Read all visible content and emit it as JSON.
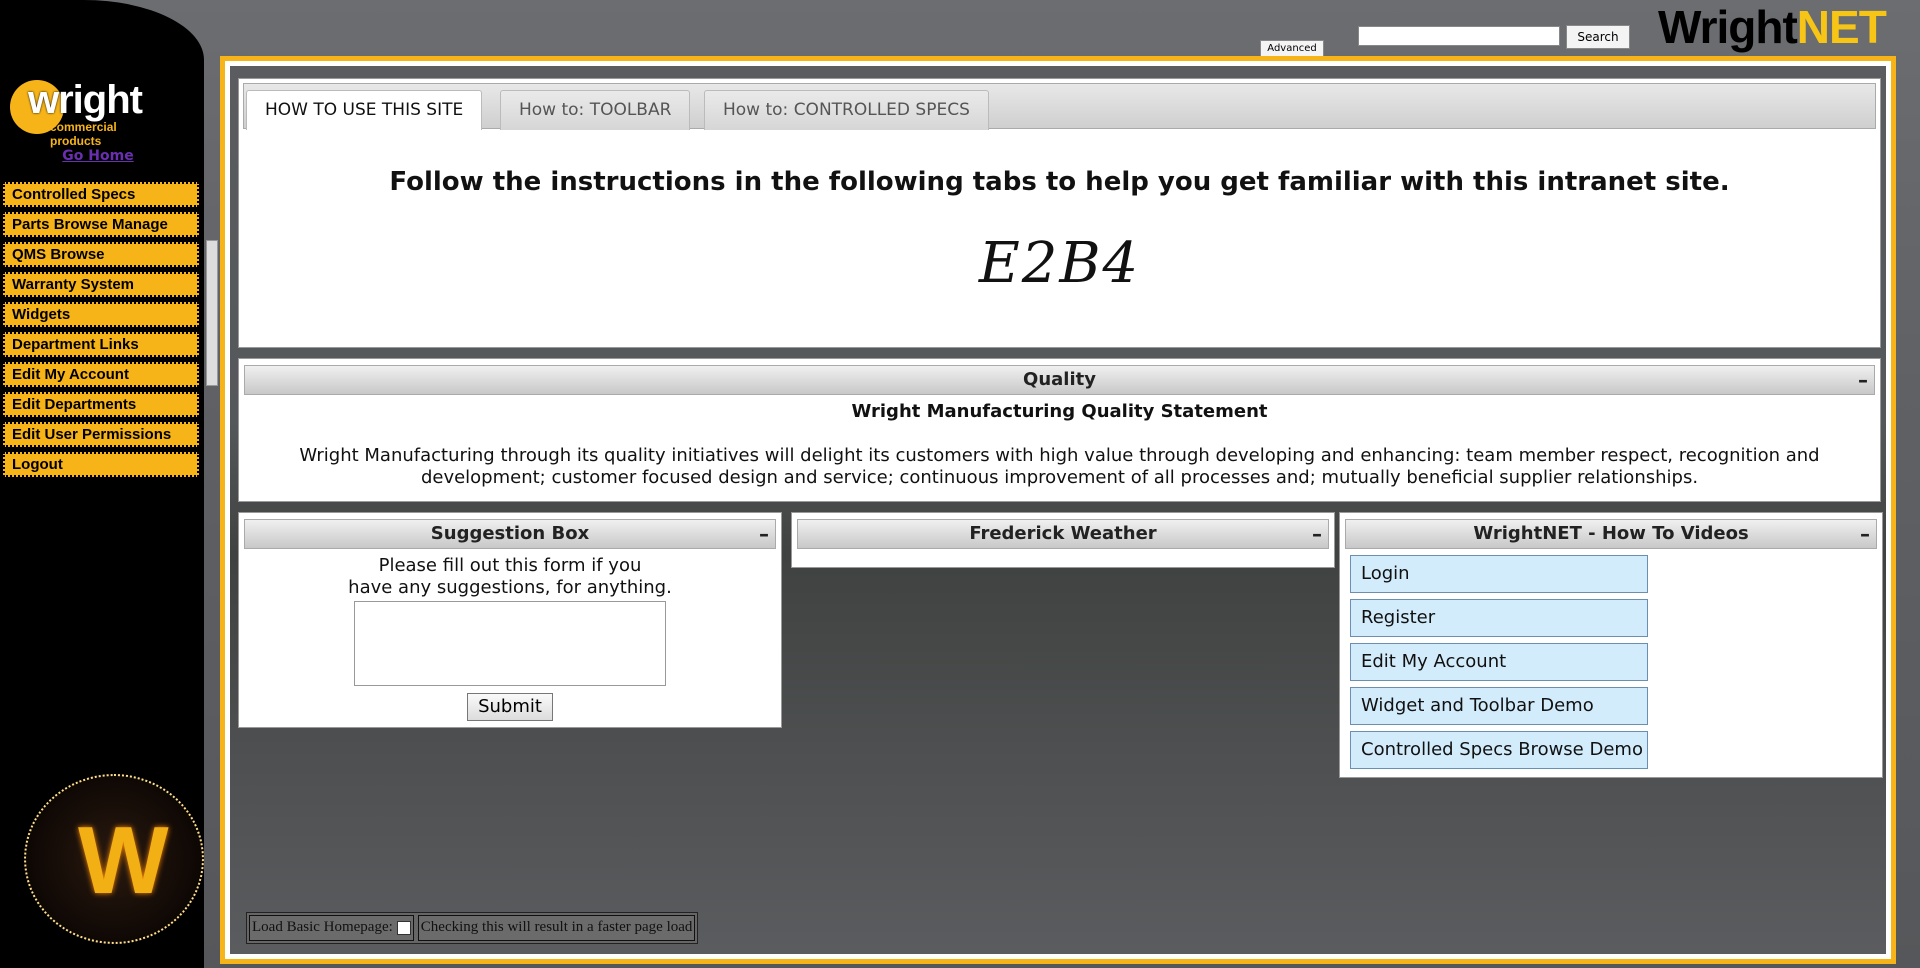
{
  "logo": {
    "wordmark": "wright",
    "tagline": "commercial products"
  },
  "sidebar": {
    "go_home": "Go Home",
    "items": [
      {
        "label": "Controlled Specs"
      },
      {
        "label": "Parts Browse Manage"
      },
      {
        "label": "QMS Browse"
      },
      {
        "label": "Warranty System"
      },
      {
        "label": "Widgets"
      },
      {
        "label": "Department Links"
      },
      {
        "label": "Edit My Account"
      },
      {
        "label": "Edit Departments"
      },
      {
        "label": "Edit User Permissions"
      },
      {
        "label": "Logout"
      }
    ]
  },
  "header": {
    "advanced_label": "Advanced",
    "search_value": "",
    "search_button": "Search",
    "brand_part1": "Wright",
    "brand_part2": "NET"
  },
  "tabs": {
    "items": [
      {
        "label": "HOW TO USE THIS SITE"
      },
      {
        "label": "How to: TOOLBAR"
      },
      {
        "label": "How to: CONTROLLED SPECS"
      }
    ],
    "intro": "Follow the instructions in the following tabs to help you get familiar with this intranet site.",
    "captcha_text": "E2B4"
  },
  "quality": {
    "title": "Quality",
    "subtitle": "Wright Manufacturing Quality Statement",
    "body": "Wright Manufacturing through its quality initiatives will delight its customers with high value through developing and enhancing: team member respect, recognition and development; customer focused design and service; continuous improvement of all processes and; mutually beneficial supplier relationships."
  },
  "suggestion": {
    "title": "Suggestion Box",
    "text_line1": "Please fill out this form if you",
    "text_line2": "have any suggestions, for anything.",
    "value": "",
    "submit": "Submit"
  },
  "weather": {
    "title": "Frederick Weather"
  },
  "videos": {
    "title": "WrightNET - How To Videos",
    "items": [
      {
        "label": "Login"
      },
      {
        "label": "Register"
      },
      {
        "label": "Edit My Account"
      },
      {
        "label": "Widget and Toolbar Demo"
      },
      {
        "label": "Controlled Specs Browse Demo"
      }
    ]
  },
  "collapse_symbol": "–",
  "basic_home": {
    "label": "Load Basic Homepage:",
    "note": "Checking this will result in a faster page load"
  },
  "colors": {
    "accent": "#f6b419",
    "brand_net": "#f6c515",
    "video_button": "#d3ecfb"
  }
}
